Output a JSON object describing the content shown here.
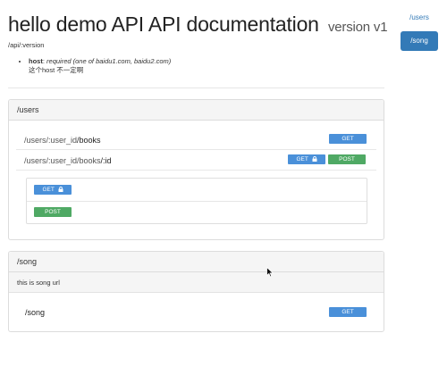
{
  "header": {
    "title": "hello demo API API documentation",
    "version": "version v1",
    "base_url": "/api/:version"
  },
  "params": [
    {
      "name": "host",
      "colon": ":",
      "required": "required (one of baidu1.com, baidu2.com)",
      "note": "这个host 不一定啊"
    }
  ],
  "resources": [
    {
      "title": "/users",
      "rows": [
        {
          "prefix": "/users/:user_id",
          "suffix": "/books",
          "method": "GET"
        },
        {
          "prefix": "/users/:user_id/books",
          "suffix": "/:id",
          "methods": [
            "GET",
            "POST"
          ]
        }
      ],
      "sub_methods": [
        "GET",
        "POST"
      ]
    },
    {
      "title": "/song",
      "description": "this is song url",
      "rows": [
        {
          "path": "/song",
          "method": "GET"
        }
      ]
    }
  ],
  "sidebar": {
    "items": [
      {
        "label": "/users",
        "active": false
      },
      {
        "label": "/song",
        "active": true
      }
    ]
  },
  "colors": {
    "get": "#4a90d9",
    "post": "#4fa964",
    "active": "#337ab7"
  },
  "icons": [
    "lock-icon",
    "mouse-cursor-icon"
  ]
}
